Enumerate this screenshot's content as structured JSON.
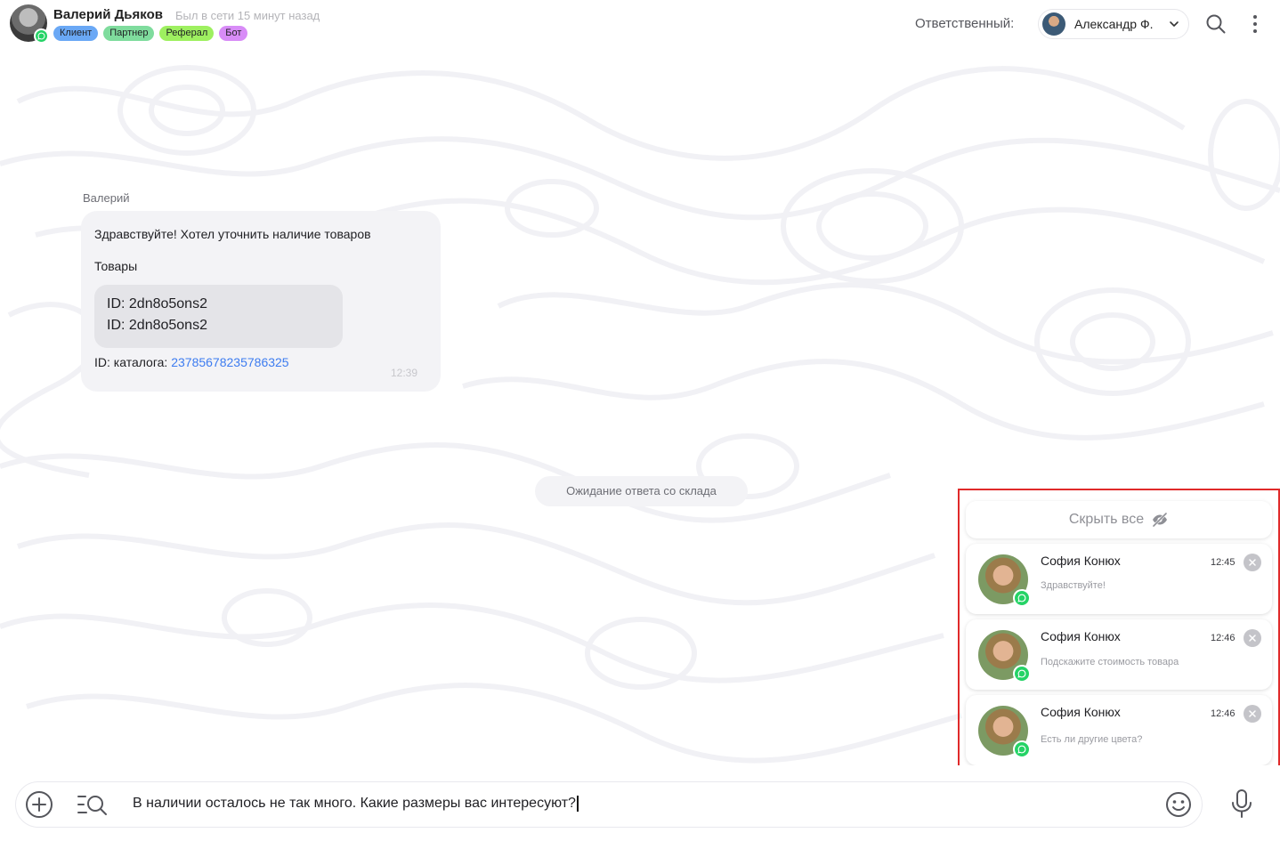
{
  "header": {
    "user_name": "Валерий Дьяков",
    "user_status": "Был в сети 15 минут назад",
    "tags": [
      "Клиент",
      "Партнер",
      "Реферал",
      "Бот"
    ],
    "responsible_label": "Ответственный:",
    "responsible_name": "Александр Ф."
  },
  "message": {
    "sender": "Валерий",
    "line1": "Здравствуйте! Хотел уточнить наличие товаров",
    "line2": "Товары",
    "ids": [
      "ID: 2dn8o5ons2",
      "ID: 2dn8o5ons2"
    ],
    "catalog_label": "ID: каталога:",
    "catalog_id": "23785678235786325",
    "time": "12:39"
  },
  "system_message": "Ожидание ответа со склада",
  "notifications": {
    "hide_all_label": "Скрыть все",
    "items": [
      {
        "name": "София Конюх",
        "time": "12:45",
        "text": "Здравствуйте!"
      },
      {
        "name": "София Конюх",
        "time": "12:46",
        "text": "Подскажите стоимость товара"
      },
      {
        "name": "София Конюх",
        "time": "12:46",
        "text": "Есть ли другие цвета?"
      }
    ]
  },
  "composer": {
    "text": "В наличии осталось не так много. Какие размеры вас интересуют?"
  },
  "colors": {
    "accent_link": "#3d7cf0",
    "whatsapp": "#25d366",
    "highlight_border": "#e02a2a"
  },
  "icons": [
    "whatsapp-icon",
    "chevron-down-icon",
    "search-icon",
    "more-vertical-icon",
    "eye-off-icon",
    "close-icon",
    "plus-circle-icon",
    "list-search-icon",
    "emoji-icon",
    "microphone-icon"
  ]
}
